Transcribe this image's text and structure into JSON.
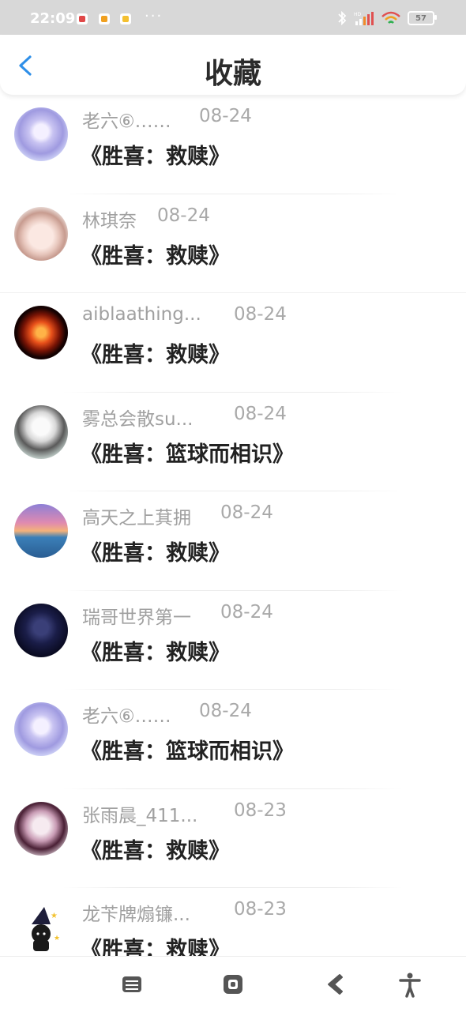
{
  "status": {
    "time": "22:09",
    "battery": "57",
    "hd": "HD"
  },
  "header": {
    "title": "收藏"
  },
  "items": [
    {
      "name": "老六⑥……",
      "date": "08-24",
      "work": "《胜喜：救赎》"
    },
    {
      "name": "林琪奈",
      "date": "08-24",
      "work": "《胜喜：救赎》"
    },
    {
      "name": "aiblaathing...",
      "date": "08-24",
      "work": "《胜喜：救赎》"
    },
    {
      "name": "雾总会散su...",
      "date": "08-24",
      "work": "《胜喜：篮球而相识》"
    },
    {
      "name": "高天之上萁拥",
      "date": "08-24",
      "work": "《胜喜：救赎》"
    },
    {
      "name": "瑞哥世界第一",
      "date": "08-24",
      "work": "《胜喜：救赎》"
    },
    {
      "name": "老六⑥……",
      "date": "08-24",
      "work": "《胜喜：篮球而相识》"
    },
    {
      "name": "张雨晨_411...",
      "date": "08-23",
      "work": "《胜喜：救赎》"
    },
    {
      "name": "龙苄牌煽镰...",
      "date": "08-23",
      "work": "《胜喜：救赎》"
    }
  ],
  "colors": {
    "accent": "#2f8fe8",
    "title": "#2b2b2b"
  }
}
